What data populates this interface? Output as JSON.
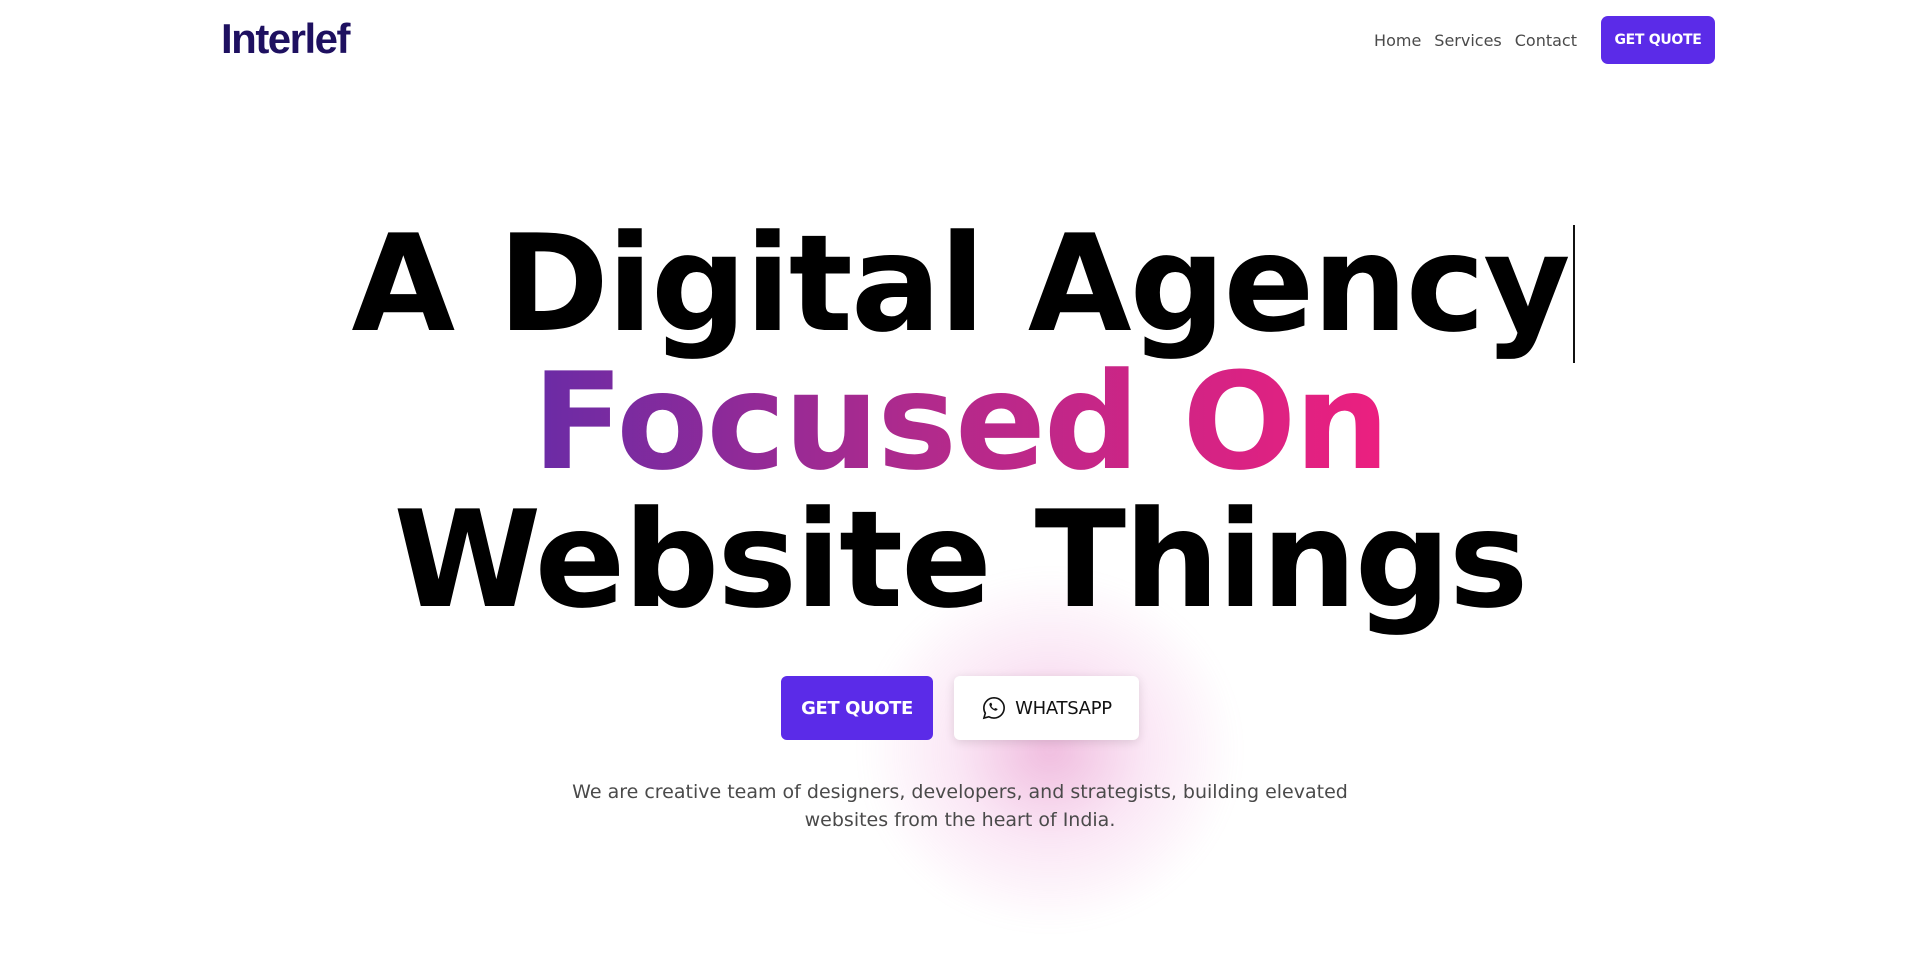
{
  "header": {
    "logo_text": "Interlef",
    "nav": {
      "home": "Home",
      "services": "Services",
      "contact": "Contact"
    },
    "cta_label": "GET QUOTE"
  },
  "hero": {
    "headline_line1": "A Digital Agency",
    "headline_line2": "Focused On",
    "headline_line3": "Website Things",
    "primary_button": "GET QUOTE",
    "secondary_button": "WHATSAPP",
    "secondary_icon": "whatsapp-icon",
    "description": "We are creative team of designers, developers, and strategists, building elevated websites from the heart of India."
  },
  "colors": {
    "accent": "#5b2be8",
    "logo": "#1e1060",
    "gradient_start": "#6a2ba6",
    "gradient_end": "#ec1f7f"
  }
}
